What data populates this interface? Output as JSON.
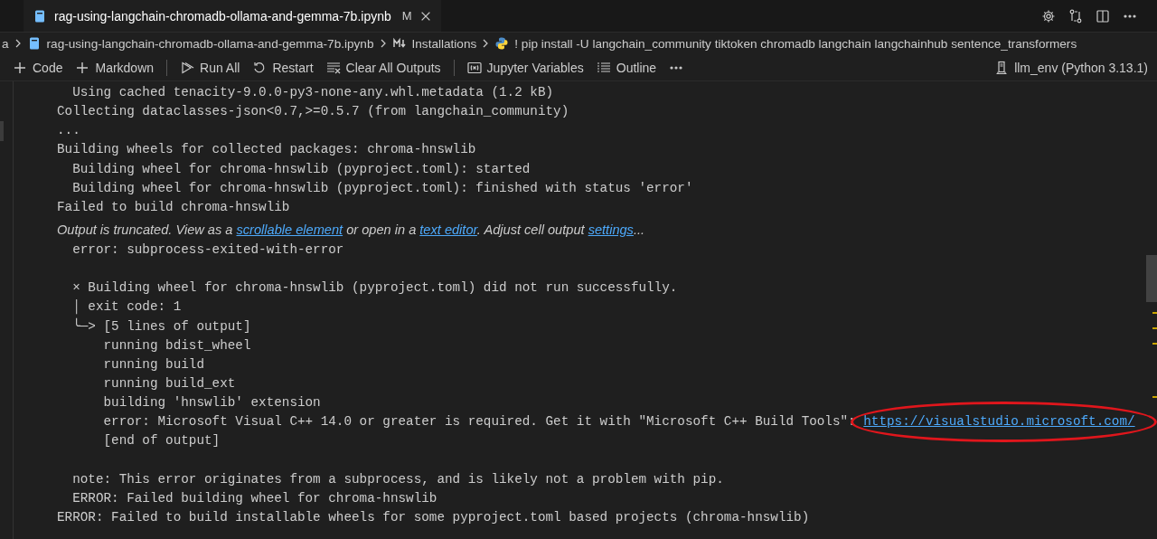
{
  "tab": {
    "title": "rag-using-langchain-chromadb-ollama-and-gemma-7b.ipynb",
    "modified": "M",
    "selected": true
  },
  "breadcrumb": [
    {
      "kind": "text",
      "label": "a"
    },
    {
      "kind": "notebook",
      "label": "rag-using-langchain-chromadb-ollama-and-gemma-7b.ipynb"
    },
    {
      "kind": "markdown",
      "label": "Installations"
    },
    {
      "kind": "python",
      "label": "! pip install -U langchain_community tiktoken chromadb langchain langchainhub sentence_transformers"
    }
  ],
  "toolbar": {
    "items": [
      {
        "kind": "add",
        "label": "Code"
      },
      {
        "kind": "add",
        "label": "Markdown"
      },
      {
        "kind": "separator"
      },
      {
        "kind": "run",
        "label": "Run All"
      },
      {
        "kind": "restart",
        "label": "Restart"
      },
      {
        "kind": "clear",
        "label": "Clear All Outputs"
      },
      {
        "kind": "separator"
      },
      {
        "kind": "variables",
        "label": "Jupyter Variables"
      },
      {
        "kind": "outline",
        "label": "Outline"
      },
      {
        "kind": "more"
      }
    ],
    "kernel": "llm_env (Python 3.13.1)"
  },
  "output": [
    {
      "kind": "mono",
      "segments": [
        {
          "text": "  Using cached tenacity-9.0.0-py3-none-any.whl.metadata (1.2 kB)"
        }
      ]
    },
    {
      "kind": "mono",
      "segments": [
        {
          "text": "Collecting dataclasses-json<0.7,>=0.5.7 (from langchain_community)"
        }
      ]
    },
    {
      "kind": "mono",
      "segments": [
        {
          "text": "..."
        }
      ]
    },
    {
      "kind": "mono",
      "segments": [
        {
          "text": "Building wheels for collected packages: chroma-hnswlib"
        }
      ]
    },
    {
      "kind": "mono",
      "segments": [
        {
          "text": "  Building wheel for chroma-hnswlib (pyproject.toml): started"
        }
      ]
    },
    {
      "kind": "mono",
      "segments": [
        {
          "text": "  Building wheel for chroma-hnswlib (pyproject.toml): finished with status 'error'"
        }
      ]
    },
    {
      "kind": "mono",
      "segments": [
        {
          "text": "Failed to build chroma-hnswlib"
        }
      ]
    },
    {
      "kind": "notice",
      "segments": [
        {
          "text": "Output is truncated. View as a "
        },
        {
          "text": "scrollable element",
          "link": true
        },
        {
          "text": " or open in a "
        },
        {
          "text": "text editor",
          "link": true
        },
        {
          "text": ". Adjust cell output "
        },
        {
          "text": "settings",
          "link": true
        },
        {
          "text": "..."
        }
      ]
    },
    {
      "kind": "mono",
      "segments": [
        {
          "text": "  error: subprocess-exited-with-error"
        }
      ]
    },
    {
      "kind": "blank"
    },
    {
      "kind": "mono",
      "segments": [
        {
          "text": "  × Building wheel for chroma-hnswlib (pyproject.toml) did not run successfully."
        }
      ]
    },
    {
      "kind": "mono",
      "segments": [
        {
          "text": "  │ exit code: 1"
        }
      ]
    },
    {
      "kind": "mono",
      "segments": [
        {
          "text": "  ╰─> [5 lines of output]"
        }
      ]
    },
    {
      "kind": "mono",
      "segments": [
        {
          "text": "      running bdist_wheel"
        }
      ]
    },
    {
      "kind": "mono",
      "segments": [
        {
          "text": "      running build"
        }
      ]
    },
    {
      "kind": "mono",
      "segments": [
        {
          "text": "      running build_ext"
        }
      ]
    },
    {
      "kind": "mono",
      "segments": [
        {
          "text": "      building 'hnswlib' extension"
        }
      ]
    },
    {
      "kind": "mono",
      "segments": [
        {
          "text": "      error: Microsoft Visual C++ 14.0 or greater is required. Get it with \"Microsoft C++ Build Tools\": "
        },
        {
          "text": "https://visualstudio.microsoft.com/",
          "link": true,
          "circled": true
        }
      ]
    },
    {
      "kind": "mono",
      "segments": [
        {
          "text": "      [end of output]"
        }
      ]
    },
    {
      "kind": "blank"
    },
    {
      "kind": "mono",
      "segments": [
        {
          "text": "  note: This error originates from a subprocess, and is likely not a problem with pip."
        }
      ]
    },
    {
      "kind": "mono",
      "segments": [
        {
          "text": "  ERROR: Failed building wheel for chroma-hnswlib"
        }
      ]
    },
    {
      "kind": "mono",
      "segments": [
        {
          "text": "ERROR: Failed to build installable wheels for some pyproject.toml based projects (chroma-hnswlib)"
        }
      ]
    }
  ]
}
